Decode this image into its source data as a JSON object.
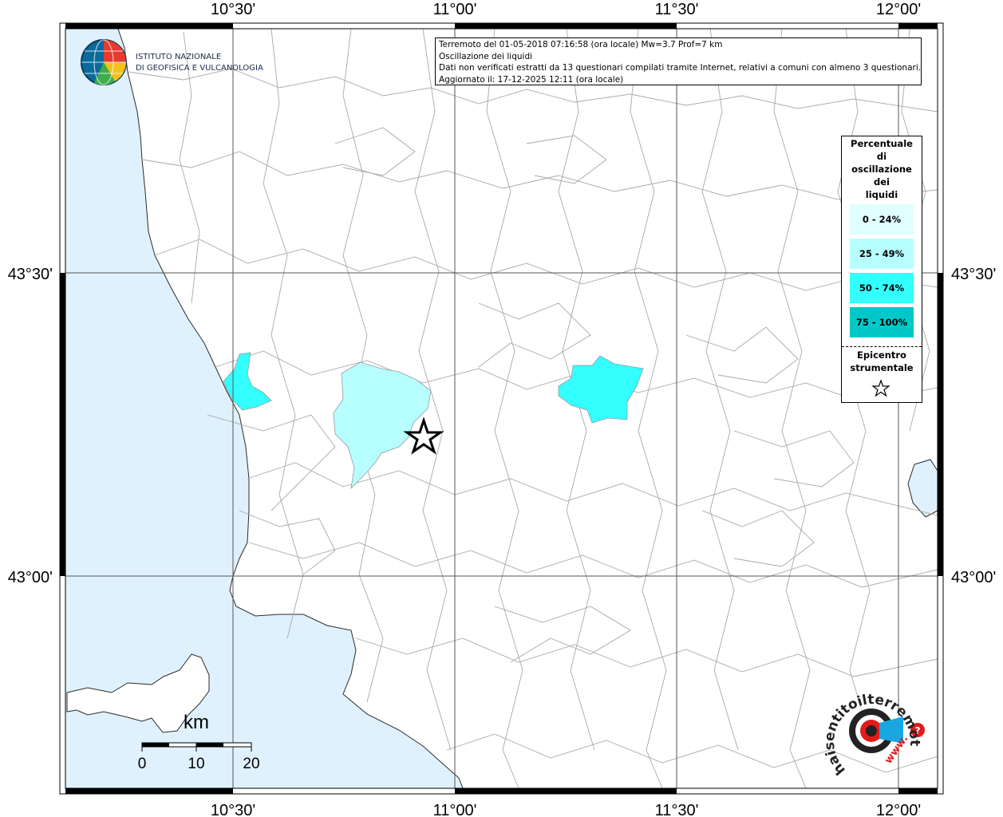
{
  "info": {
    "line1": "Terremoto del 01-05-2018 07:16:58 (ora locale) Mw=3.7 Prof=7 km",
    "line2": "Oscillazione dei liquidi",
    "line3": "Dati non verificati estratti da 13 questionari compilati tramite Internet, relativi a comuni con almeno 3 questionari.",
    "line4": "Aggiornato il: 17-12-2025 12:11 (ora locale)"
  },
  "axes": {
    "top": [
      "10°30'",
      "11°00'",
      "11°30'",
      "12°00'"
    ],
    "bottom": [
      "10°30'",
      "11°00'",
      "11°30'",
      "12°00'"
    ],
    "left": [
      "43°30'",
      "43°00'"
    ],
    "right": [
      "43°30'",
      "43°00'"
    ]
  },
  "legend": {
    "title_lines": [
      "Percentuale",
      "di",
      "oscillazione",
      "dei",
      "liquidi"
    ],
    "classes": [
      {
        "label": "0 - 24%",
        "color": "#e0ffff"
      },
      {
        "label": "25 - 49%",
        "color": "#b7ffff"
      },
      {
        "label": "50 - 74%",
        "color": "#33ffff"
      },
      {
        "label": "75 - 100%",
        "color": "#00c8c8"
      }
    ],
    "epicenter_title": [
      "Epicentro",
      "strumentale"
    ]
  },
  "logo": {
    "line1": "ISTITUTO NAZIONALE",
    "line2": "DI GEOFISICA E VULCANOLOGIA"
  },
  "scalebar": {
    "unit": "km",
    "labels": [
      "0",
      "10",
      "20"
    ]
  },
  "hsit": {
    "text": "haisentitoilterremoto.it",
    "www": "www."
  },
  "colors": {
    "sea": "#dff1fc",
    "class_25_49": "#b7ffff",
    "class_50_74": "#33ffff",
    "border": "#000000"
  }
}
